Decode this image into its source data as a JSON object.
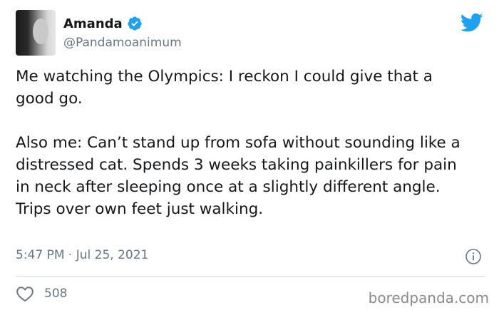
{
  "author": {
    "display_name": "Amanda",
    "handle": "@Pandamoanimum",
    "verified": true
  },
  "tweet": {
    "paragraphs": [
      "Me watching the Olympics: I reckon I could give that a good go.",
      "Also me: Can’t stand up from sofa without sounding like a distressed cat. Spends 3 weeks taking painkillers for pain in neck after sleeping once at a slightly different angle. Trips over own feet just walking."
    ],
    "timestamp": "5:47 PM · Jul 25, 2021",
    "likes": "508"
  },
  "watermark": "boredpanda.com",
  "colors": {
    "twitter_blue": "#1da1f2",
    "secondary_text": "#657786"
  },
  "icons": {
    "brand": "twitter-bird-icon",
    "verified": "verified-badge-icon",
    "info": "info-icon",
    "like": "heart-icon"
  }
}
